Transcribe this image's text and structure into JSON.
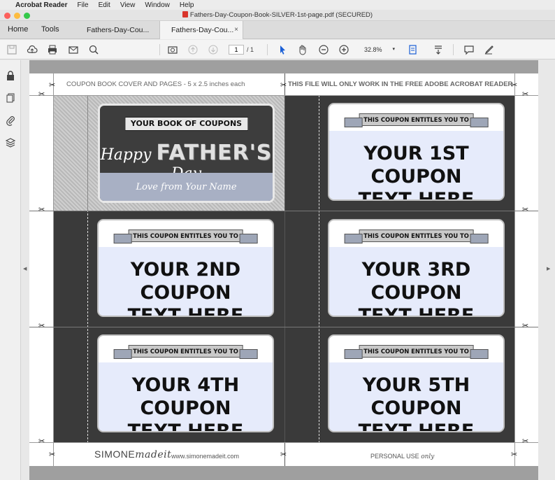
{
  "menubar": {
    "app": "Acrobat Reader",
    "items": [
      "File",
      "Edit",
      "View",
      "Window",
      "Help"
    ]
  },
  "window": {
    "title": "Fathers-Day-Coupon-Book-SILVER-1st-page.pdf (SECURED)",
    "traffic": [
      "#fc605c",
      "#fdbc40",
      "#34c84a"
    ]
  },
  "tabs": {
    "home": "Home",
    "tools": "Tools",
    "doc1": "Fathers-Day-Cou...",
    "doc2": "Fathers-Day-Cou...",
    "close": "×"
  },
  "toolbar": {
    "page_current": "1",
    "page_total": "/ 1",
    "zoom": "32.8%",
    "zoom_caret": "▾"
  },
  "rail": {
    "left_toggle": "◀",
    "right_toggle": "▶"
  },
  "page": {
    "header_left": "COUPON BOOK COVER AND PAGES - 5 x 2.5 inches each",
    "header_right": "THIS FILE WILL ONLY WORK IN THE FREE ADOBE ACROBAT READER",
    "cover": {
      "banner": "YOUR BOOK OF COUPONS",
      "happy": "Happy",
      "fathers": "FATHER'S",
      "day": "Day",
      "love": "Love from Your Name"
    },
    "coupon_banner": "THIS COUPON ENTITLES YOU TO",
    "coupons": [
      {
        "line1": "YOUR 1ST COUPON",
        "line2": "TEXT HERE"
      },
      {
        "line1": "YOUR 2ND COUPON",
        "line2": "TEXT HERE"
      },
      {
        "line1": "YOUR 3RD COUPON",
        "line2": "TEXT HERE"
      },
      {
        "line1": "YOUR 4TH COUPON",
        "line2": "TEXT HERE"
      },
      {
        "line1": "YOUR 5TH COUPON",
        "line2": "TEXT HERE"
      }
    ],
    "footer_brand": "SIMONE",
    "footer_brand_script": "madeit",
    "footer_url": "www.simonemadeit.com",
    "footer_right": "PERSONAL USE",
    "footer_right_script": "only",
    "scissors": "✂"
  }
}
